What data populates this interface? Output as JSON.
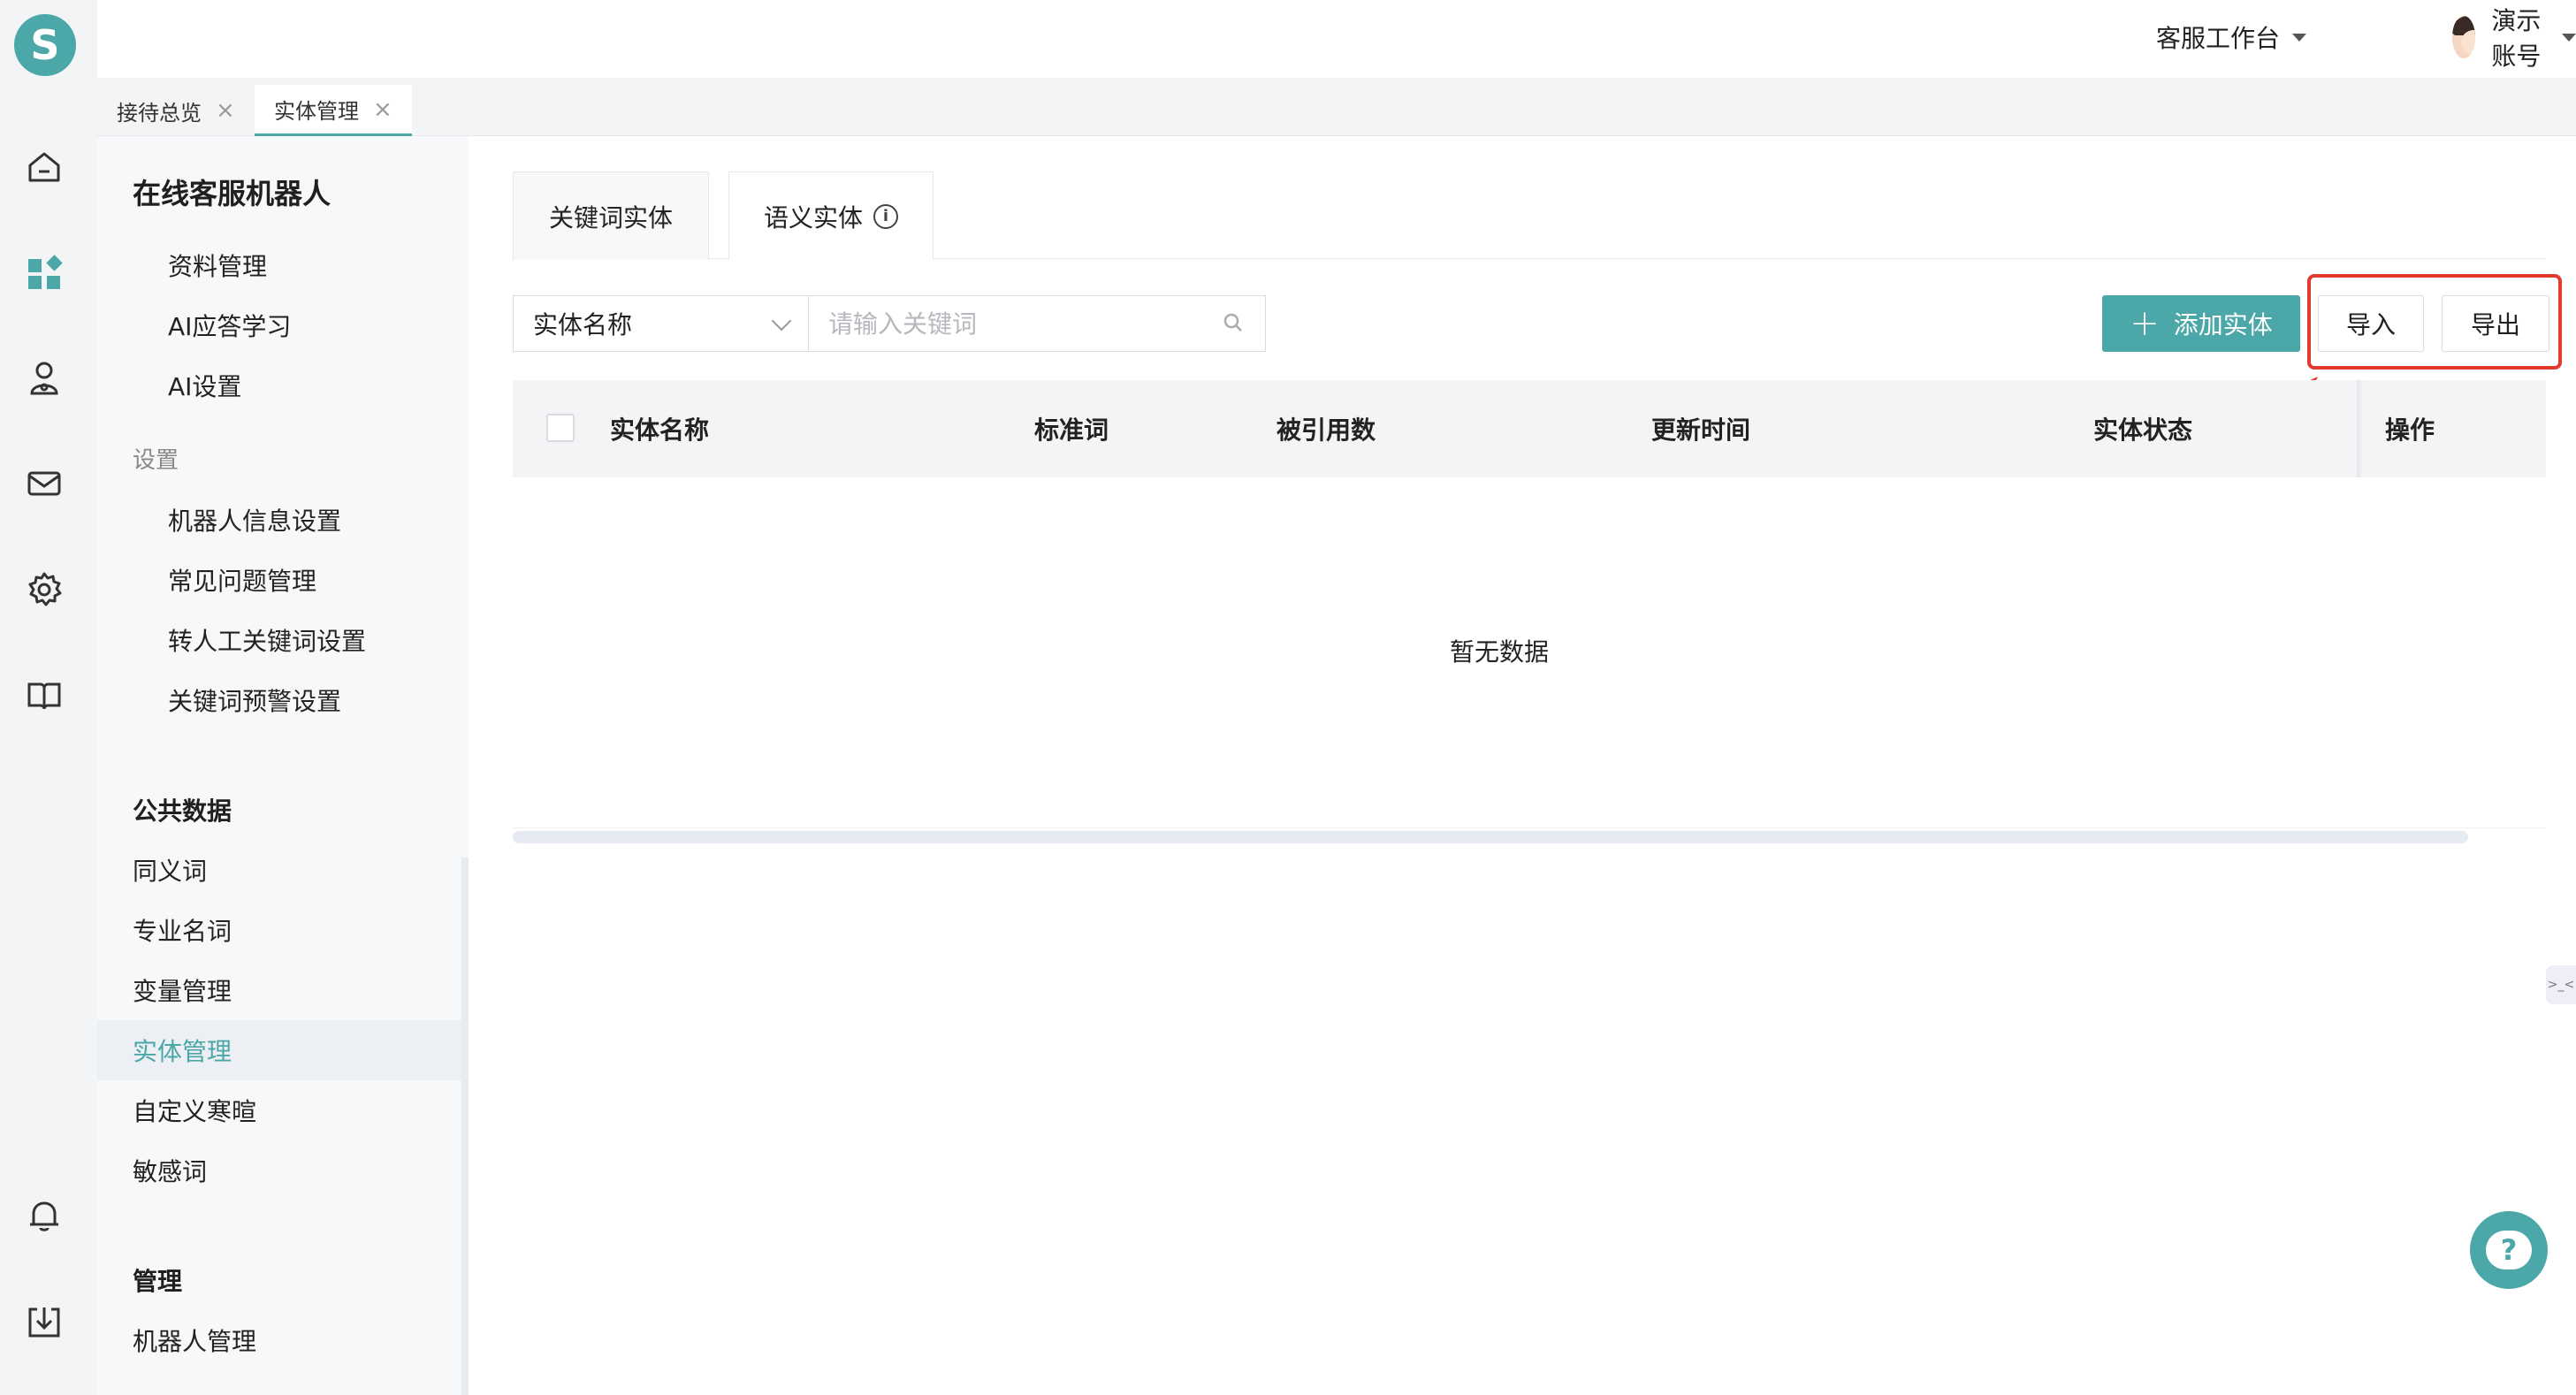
{
  "app": {
    "logo_letter": "S",
    "accent_color": "#4ba7a8",
    "highlight_color": "#e23b2e"
  },
  "header": {
    "workbench_label": "客服工作台",
    "user_name": "演示账号"
  },
  "rail_icons": [
    "home-icon",
    "apps-icon",
    "agent-icon",
    "mail-icon",
    "settings-icon",
    "book-icon",
    "bell-icon",
    "download-icon"
  ],
  "page_tabs": [
    {
      "label": "接待总览",
      "active": false
    },
    {
      "label": "实体管理",
      "active": true
    }
  ],
  "subnav": {
    "title": "在线客服机器人",
    "bot_items": [
      "资料管理",
      "AI应答学习",
      "AI设置"
    ],
    "settings_group": "设置",
    "settings_items": [
      "机器人信息设置",
      "常见问题管理",
      "转人工关键词设置",
      "关键词预警设置"
    ],
    "public_section": "公共数据",
    "public_items": [
      "同义词",
      "专业名词",
      "变量管理",
      "实体管理",
      "自定义寒暄",
      "敏感词"
    ],
    "active_item": "实体管理",
    "manage_section": "管理",
    "manage_items": [
      "机器人管理"
    ]
  },
  "content_tabs": [
    {
      "label": "关键词实体",
      "active": false
    },
    {
      "label": "语义实体",
      "active": true
    }
  ],
  "filter": {
    "field": "实体名称",
    "placeholder": "请输入关键词"
  },
  "actions": {
    "add_label": "添加实体",
    "import_label": "导入",
    "export_label": "导出"
  },
  "table": {
    "columns": [
      "实体名称",
      "标准词",
      "被引用数",
      "更新时间",
      "实体状态",
      "操作"
    ],
    "rows": [],
    "empty_text": "暂无数据"
  },
  "side_tab_text": ">_<",
  "help_symbol": "?"
}
